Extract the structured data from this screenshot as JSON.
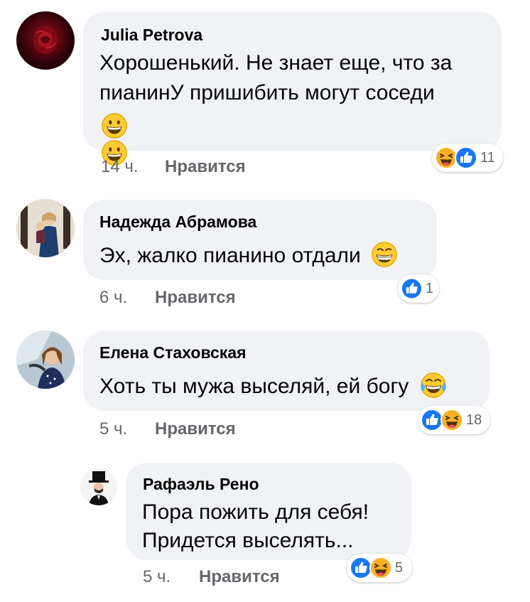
{
  "comments": [
    {
      "author": "Julia Petrova",
      "lines": [
        "Хорошенький. Не знает еще, что за",
        "пианинУ пришибить могут соседи"
      ],
      "emoji_line": [
        "grinning-face",
        "grinning-face"
      ],
      "time": "14 ч.",
      "like_label": "Нравится",
      "reactions": [
        "laughing-face",
        "like"
      ],
      "reaction_count": "11"
    },
    {
      "author": "Надежда Абрамова",
      "lines": [
        "Эх, жалко пианино отдали"
      ],
      "trailing_emoji": "grinning-squinting-face",
      "time": "6 ч.",
      "like_label": "Нравится",
      "reactions": [
        "like"
      ],
      "reaction_count": "1"
    },
    {
      "author": "Елена Стаховская",
      "lines": [
        "Хоть ты мужа выселяй, ей богу"
      ],
      "trailing_emoji": "tears-of-joy-face",
      "time": "5 ч.",
      "like_label": "Нравится",
      "reactions": [
        "like",
        "laughing-face"
      ],
      "reaction_count": "18"
    },
    {
      "author": "Рафаэль Рено",
      "lines": [
        "Пора пожить для  себя!",
        "Придется  выселять..."
      ],
      "time": "5 ч.",
      "like_label": "Нравится",
      "reactions": [
        "like",
        "laughing-face"
      ],
      "reaction_count": "5"
    }
  ],
  "colors": {
    "bubble": "#f0f2f5",
    "like_blue": "#1877f2",
    "haha_yellow": "#f7b125",
    "meta_gray": "#65676b"
  }
}
